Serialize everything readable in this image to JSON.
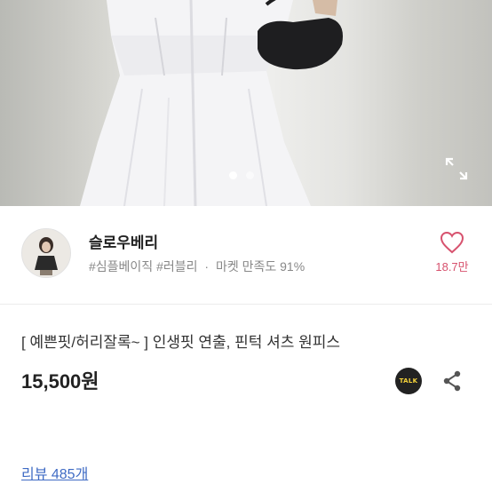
{
  "gallery": {
    "image_alt": "product photo",
    "page_count": 2,
    "active_index": 0,
    "expand_icon": "expand-icon"
  },
  "seller": {
    "name": "슬로우베리",
    "tag_1": "#심플베이직",
    "tag_2": "#러블리",
    "separator": "·",
    "satisfaction": "마켓 만족도 91%",
    "like_icon": "heart-icon",
    "like_count": "18.7만",
    "accent_color": "#d7526e"
  },
  "product": {
    "title": "[ 예쁜핏/허리잘록~ ] 인생핏 연출, 핀턱 셔츠 원피스",
    "price": "15,500원",
    "talk_label": "TALK",
    "share_icon": "share-icon"
  },
  "reviews": {
    "link_text": "리뷰 485개",
    "link_color": "#3f6bc4"
  }
}
